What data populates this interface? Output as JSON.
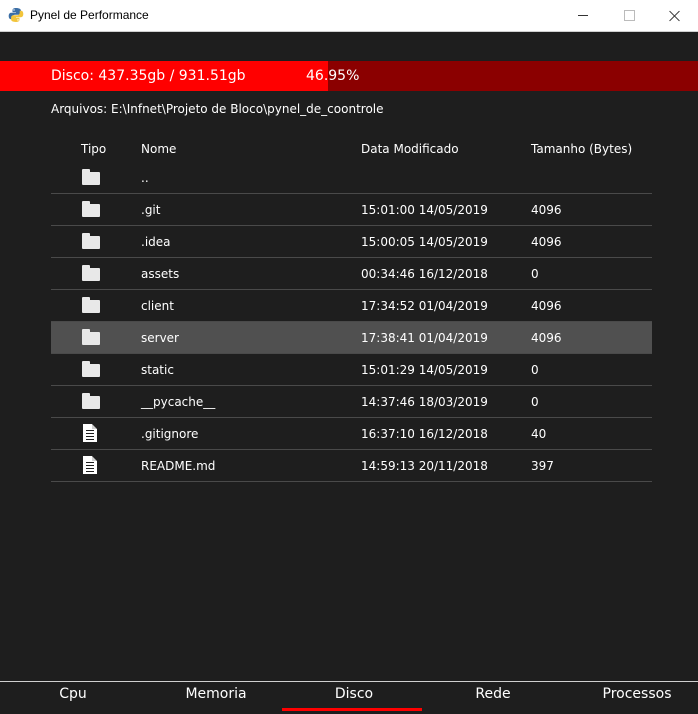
{
  "window": {
    "title": "Pynel de Performance",
    "icon": "python-icon"
  },
  "disk": {
    "label": "Disco: 437.35gb / 931.51gb",
    "percent_text": "46.95%",
    "used_fraction": 0.4695,
    "colors": {
      "used": "#ff0000",
      "free": "#8b0000"
    }
  },
  "path": {
    "text": "Arquivos: E:\\Infnet\\Projeto de Bloco\\pynel_de_coontrole"
  },
  "table": {
    "headers": {
      "type": "Tipo",
      "name": "Nome",
      "date": "Data Modificado",
      "size": "Tamanho (Bytes)"
    },
    "rows": [
      {
        "icon": "folder-icon",
        "name": "..",
        "date": "",
        "size": ""
      },
      {
        "icon": "folder-icon",
        "name": ".git",
        "date": "15:01:00 14/05/2019",
        "size": "4096"
      },
      {
        "icon": "folder-icon",
        "name": ".idea",
        "date": "15:00:05 14/05/2019",
        "size": "4096"
      },
      {
        "icon": "folder-icon",
        "name": "assets",
        "date": "00:34:46 16/12/2018",
        "size": "0"
      },
      {
        "icon": "folder-icon",
        "name": "client",
        "date": "17:34:52 01/04/2019",
        "size": "4096"
      },
      {
        "icon": "folder-icon",
        "name": "server",
        "date": "17:38:41 01/04/2019",
        "size": "4096",
        "selected": true
      },
      {
        "icon": "folder-icon",
        "name": "static",
        "date": "15:01:29 14/05/2019",
        "size": "0"
      },
      {
        "icon": "folder-icon",
        "name": "__pycache__",
        "date": "14:37:46 18/03/2019",
        "size": "0"
      },
      {
        "icon": "file-icon",
        "name": ".gitignore",
        "date": "16:37:10 16/12/2018",
        "size": "40"
      },
      {
        "icon": "file-icon",
        "name": "README.md",
        "date": "14:59:13 20/11/2018",
        "size": "397"
      }
    ],
    "colors": {
      "selected_row": "#505050",
      "divider": "#4a4a4a"
    }
  },
  "tabs": {
    "items": [
      "Cpu",
      "Memoria",
      "Disco",
      "Rede",
      "Processos"
    ],
    "active": "Disco",
    "active_color": "#ff0000"
  }
}
